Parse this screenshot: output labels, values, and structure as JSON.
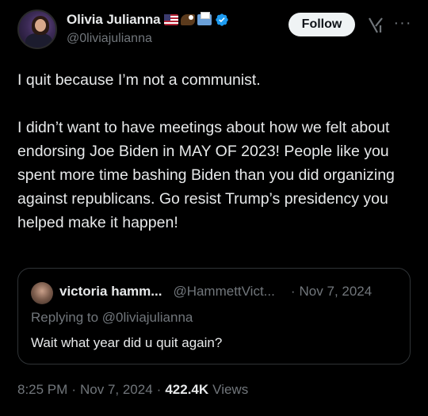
{
  "author": {
    "display_name": "Olivia Julianna",
    "handle": "@0liviajulianna",
    "badge_emojis": [
      "us-flag-icon",
      "eagle-icon",
      "ballot-box-icon"
    ],
    "verified": true,
    "verified_color": "#1d9bf0"
  },
  "actions": {
    "follow_label": "Follow"
  },
  "tweet": {
    "paragraphs": [
      "I quit because I’m not a communist.",
      "I didn’t want to have meetings about how we felt about endorsing Joe Biden in MAY OF 2023! People like you spent more time bashing Biden than you did organizing against republicans. Go resist Trump’s presidency you helped make it happen!"
    ]
  },
  "quote": {
    "name": "victoria hamm...",
    "handle": "@HammettVict...",
    "separator": "·",
    "date": "Nov 7, 2024",
    "replying_to": "Replying to @0liviajulianna",
    "text": "Wait what year did u quit again?"
  },
  "meta": {
    "time": "8:25 PM",
    "sep": "·",
    "date": "Nov 7, 2024",
    "views_count": "422.4K",
    "views_label": "Views"
  },
  "colors": {
    "background": "#000000",
    "text": "#e7e9ea",
    "muted": "#71767b",
    "border": "#2f3336",
    "follow_bg": "#eff3f4"
  }
}
